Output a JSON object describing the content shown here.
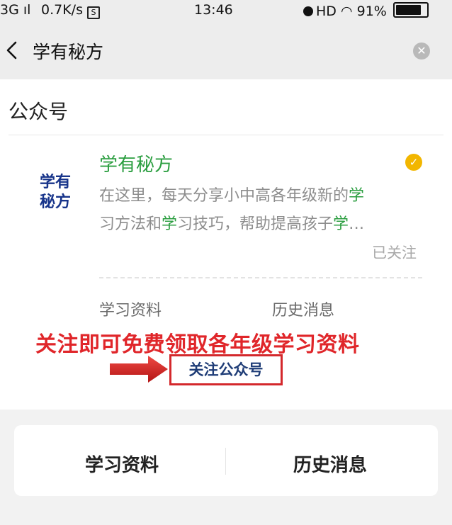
{
  "status_bar": {
    "signal": "3G",
    "net_speed": "0.7K/s",
    "sim_icon_label": "S",
    "time": "13:46",
    "hd": "HD",
    "battery": "91%",
    "battery_level": 0.91
  },
  "header": {
    "title": "学有秘方",
    "back_icon": "chevron-left-icon",
    "clear_icon": "close-circle-icon"
  },
  "section": {
    "title": "公众号"
  },
  "account": {
    "logo_line1": "学有",
    "logo_line2": "秘方",
    "name": "学有秘方",
    "desc1_a": "在这里，每天分享小中高各年级新的",
    "desc1_b": "学",
    "desc2_a": "习方法和",
    "desc2_b": "学",
    "desc2_c": "习技巧，帮助提高孩子",
    "desc2_d": "学",
    "desc2_e": "…",
    "followed": "已关注",
    "verified_icon": "verified-check-icon"
  },
  "menu": {
    "materials": "学习资料",
    "history": "历史消息"
  },
  "promo": {
    "text": "关注即可免费领取各年级学习资料",
    "button": "关注公众号"
  },
  "bottom_tabs": {
    "materials": "学习资料",
    "history": "历史消息"
  },
  "colors": {
    "accent_green": "#2b9e40",
    "promo_red": "#e0262a",
    "logo_blue": "#17348a",
    "verified_orange": "#f2b600"
  }
}
